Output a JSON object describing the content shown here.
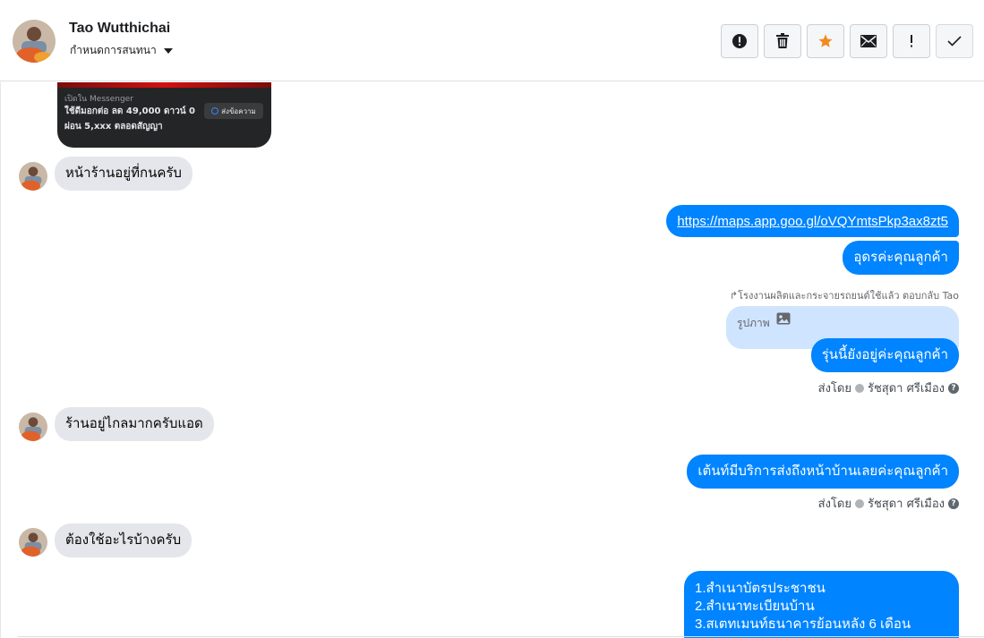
{
  "header": {
    "contact_name": "Tao Wutthichai",
    "assign_label": "กำหนดการสนทนา",
    "toolbar": [
      {
        "name": "report-button",
        "icon": "alert-circle-icon",
        "active_color": "#1c1e21"
      },
      {
        "name": "delete-button",
        "icon": "trash-icon",
        "active_color": "#1c1e21"
      },
      {
        "name": "star-button",
        "icon": "star-icon",
        "active_color": "#f28b1d"
      },
      {
        "name": "mark-unread-button",
        "icon": "envelope-icon",
        "active_color": "#1c1e21"
      },
      {
        "name": "follow-up-button",
        "icon": "exclamation-icon",
        "active_color": "#1c1e21"
      },
      {
        "name": "done-button",
        "icon": "check-icon",
        "active_color": "#1c1e21"
      }
    ]
  },
  "preview_card": {
    "label": "เปิดใน Messenger",
    "line1": "ใช้ดีมอกต่อ ลด 49,000 ดาวน์ 0",
    "line2": "ผ่อน 5,xxx ตลอดสัญญา",
    "button": "ส่งข้อความ"
  },
  "messages": [
    {
      "dir": "in",
      "text": "หน้าร้านอยู่ที่กนครับ"
    },
    {
      "dir": "out",
      "text": "https://maps.app.goo.gl/oVQYmtsPkp3ax8zt5",
      "link": true
    },
    {
      "dir": "out",
      "text": "อุดรค่ะคุณลูกค้า"
    },
    {
      "dir": "out",
      "text": "รุ่นนี้ยังอยู่ค่ะคุณลูกค้า"
    },
    {
      "dir": "in",
      "text": "ร้านอยู่ไกลมากครับแอด"
    },
    {
      "dir": "out",
      "text": "เต้นท์มีบริการส่งถึงหน้าบ้านเลยค่ะคุณลูกค้า"
    },
    {
      "dir": "in",
      "text": "ต้องใช้อะไรบ้างครับ"
    }
  ],
  "list_message": {
    "lines": [
      "1.สำเนาบัตรประชาชน",
      "2.สำเนาทะเบียนบ้าน",
      "3.สเตทเมนท์ธนาคารย้อนหลัง 6 เดือน"
    ]
  },
  "reply": {
    "label": "โรงงานผลิตและกระจายรถยนต์ใช้แล้ว ตอบกลับ Tao",
    "quote_text": "รูปภาพ"
  },
  "sent_by": {
    "prefix": "ส่งโดย",
    "agent": "รัชสุดา ศรีเมือง"
  },
  "colors": {
    "outgoing": "#0084ff",
    "incoming": "#e4e6eb",
    "reply_quote": "#cfe4ff",
    "star": "#f28b1d"
  }
}
